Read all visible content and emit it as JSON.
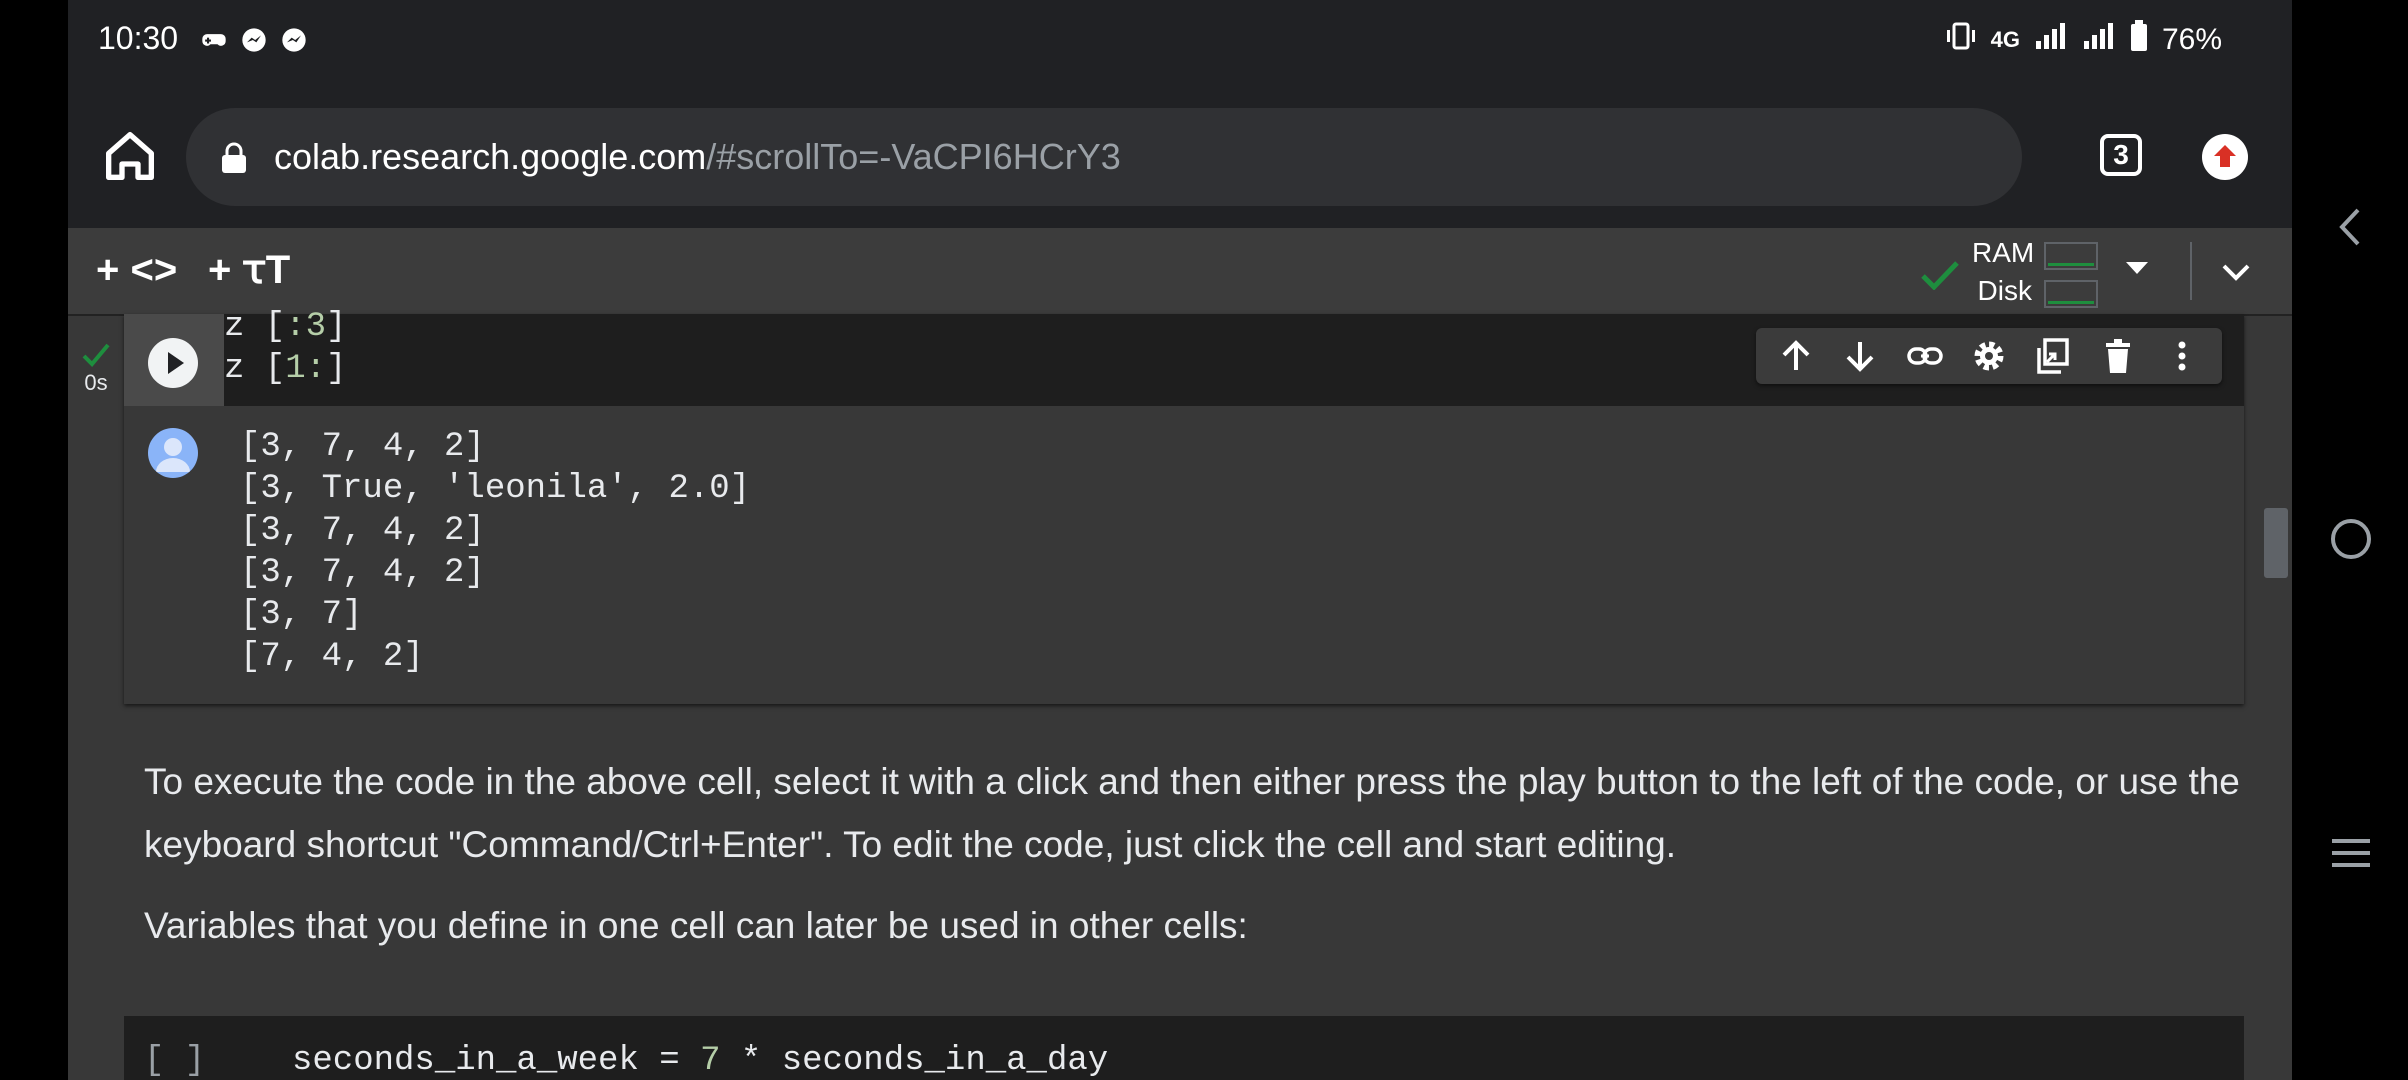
{
  "status_bar": {
    "time": "10:30",
    "app_icons": [
      "game-controller-icon",
      "messenger-icon",
      "messenger-icon"
    ],
    "network": "4G",
    "battery": "76%"
  },
  "browser": {
    "url_host": "colab.research.google.com",
    "url_path": "/#scrollTo=-VaCPI6HCrY3",
    "tab_count": "3"
  },
  "colab_toolbar": {
    "add_code_label": "+ <>",
    "add_text_label": "+ ꚍT",
    "ram_label": "RAM",
    "disk_label": "Disk"
  },
  "code_cell": {
    "exec_time": "0s",
    "lines": [
      {
        "prefix": "z [",
        "slice": ":3",
        "suffix": "]"
      },
      {
        "prefix": "z [",
        "slice": "1:",
        "suffix": "]"
      }
    ],
    "output": [
      "[3, 7, 4, 2]",
      "[3, True, 'leonila', 2.0]",
      "[3, 7, 4, 2]",
      "[3, 7, 4, 2]",
      "[3, 7]",
      "[7, 4, 2]"
    ]
  },
  "text_cell": {
    "paragraph1": "To execute the code in the above cell, select it with a click and then either press the play button to the left of the code, or use the keyboard shortcut \"Command/Ctrl+Enter\". To edit the code, just click the cell and start editing.",
    "paragraph2": "Variables that you define in one cell can later be used in other cells:"
  },
  "next_cell": {
    "bracket": "[ ]",
    "code_before": "seconds_in_a_week = ",
    "code_num": "7",
    "code_after": " * seconds_in_a_day"
  }
}
